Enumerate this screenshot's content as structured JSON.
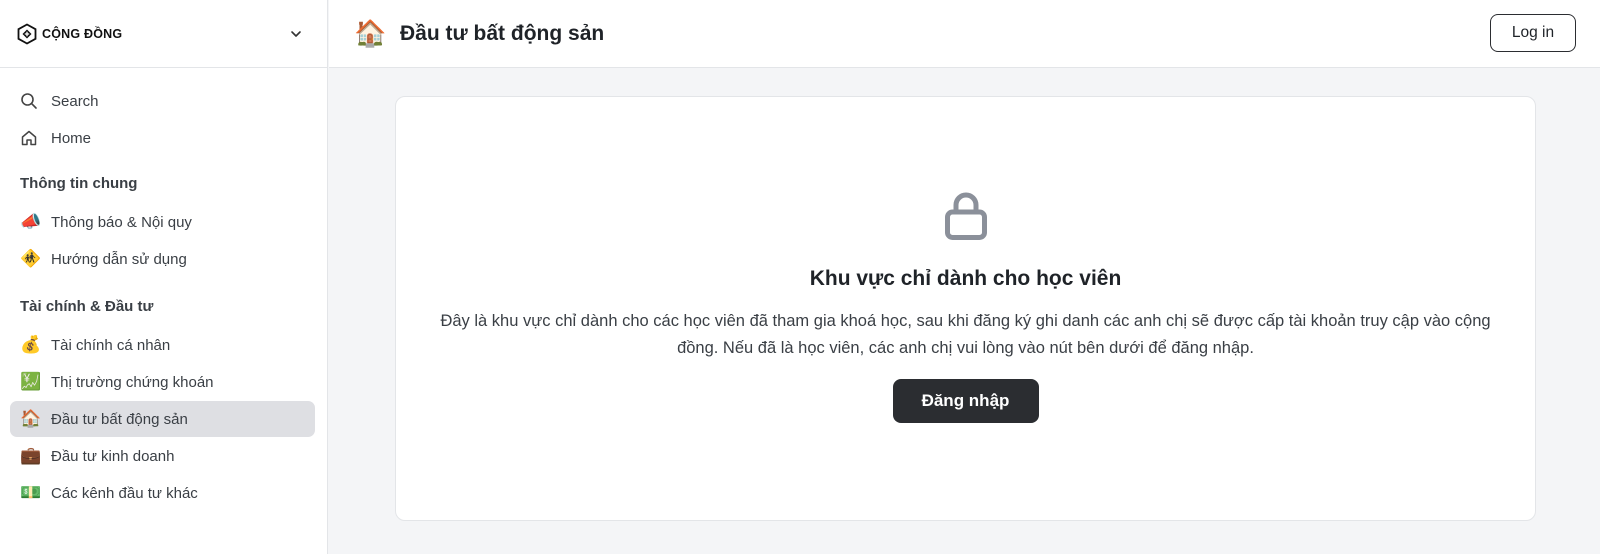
{
  "brand": {
    "name": "CỘNG ĐỒNG"
  },
  "header": {
    "emoji": "🏠",
    "title": "Đầu tư bất động sản",
    "login_label": "Log in"
  },
  "sidebar": {
    "top_items": [
      {
        "icon": "search-icon",
        "label": "Search"
      },
      {
        "icon": "home-icon",
        "label": "Home"
      }
    ],
    "sections": [
      {
        "title": "Thông tin chung",
        "items": [
          {
            "emoji": "📣",
            "label": "Thông báo & Nội quy"
          },
          {
            "emoji": "🚸",
            "label": "Hướng dẫn sử dụng"
          }
        ]
      },
      {
        "title": "Tài chính & Đầu tư",
        "items": [
          {
            "emoji": "💰",
            "label": "Tài chính cá nhân"
          },
          {
            "emoji": "💹",
            "label": "Thị trường chứng khoán"
          },
          {
            "emoji": "🏠",
            "label": "Đầu tư bất động sản",
            "active": true
          },
          {
            "emoji": "💼",
            "label": "Đầu tư kinh doanh"
          },
          {
            "emoji": "💵",
            "label": "Các kênh đầu tư khác"
          }
        ]
      }
    ]
  },
  "main": {
    "lock_icon": "lock-icon",
    "title": "Khu vực chỉ dành cho học viên",
    "description": "Đây là khu vực chỉ dành cho các học viên đã tham gia khoá học, sau khi đăng ký ghi danh các anh chị sẽ được cấp tài khoản truy cập vào cộng đồng. Nếu đã là học viên, các anh chị vui lòng vào nút bên dưới để đăng nhập.",
    "button_label": "Đăng nhập"
  },
  "colors": {
    "accent": "#2b2d31",
    "active_bg": "#dedfe3",
    "page_bg": "#f4f5f7",
    "lock": "#8b909a"
  }
}
